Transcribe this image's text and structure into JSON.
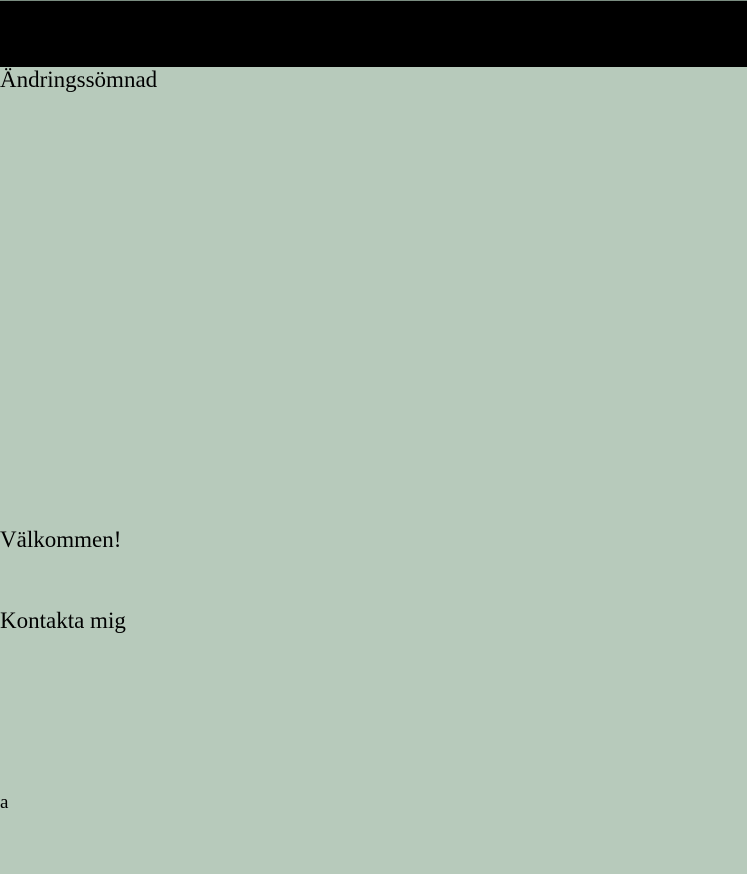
{
  "header": {
    "site_title": "Ändringssömnad"
  },
  "main": {
    "welcome": "Välkommen!",
    "contact_link": "Kontakta mig"
  },
  "footer": {
    "text": "a"
  },
  "colors": {
    "background": "#b7cabb",
    "top_bar": "#000000",
    "text": "#000000"
  }
}
